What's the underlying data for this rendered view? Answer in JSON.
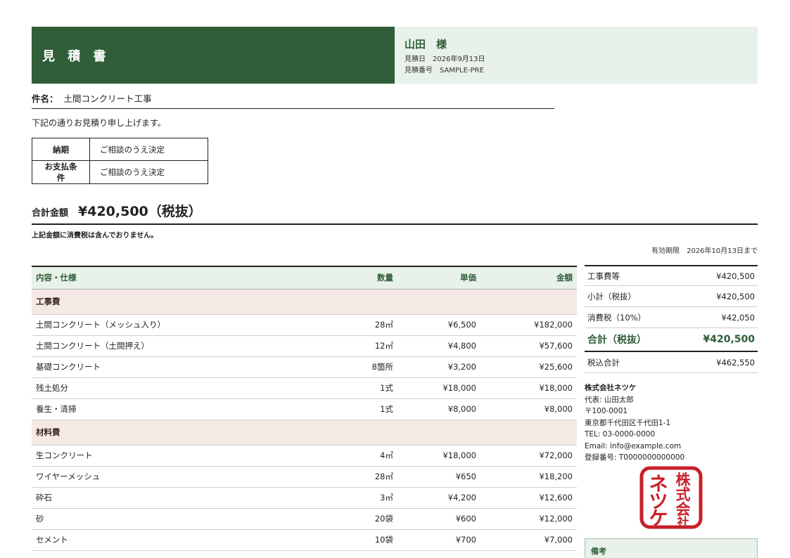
{
  "header": {
    "title": "見 積 書",
    "client": "山田　様",
    "date_label": "見積日",
    "date_value": "2026年9月13日",
    "number_label": "見積番号",
    "number_value": "SAMPLE-PRE"
  },
  "subject": {
    "label": "件名：",
    "value": "土間コンクリート工事"
  },
  "intro": "下記の通りお見積り申し上げます。",
  "terms": [
    {
      "label": "納期",
      "value": "ご相談のうえ決定"
    },
    {
      "label": "お支払条件",
      "value": "ご相談のうえ決定"
    }
  ],
  "total": {
    "label": "合計金額",
    "value": "¥420,500（税抜）"
  },
  "tax_note": "上記金額に消費税は含んでおりません。",
  "validity": {
    "label": "有効期限",
    "value": "2026年10月13日まで"
  },
  "table": {
    "headers": [
      "内容・仕様",
      "数量",
      "単価",
      "金額"
    ],
    "categories": [
      {
        "name": "工事費",
        "rows": [
          [
            "土間コンクリート（メッシュ入り）",
            "28㎡",
            "¥6,500",
            "¥182,000"
          ],
          [
            "土間コンクリート（土間押え）",
            "12㎡",
            "¥4,800",
            "¥57,600"
          ],
          [
            "基礎コンクリート",
            "8箇所",
            "¥3,200",
            "¥25,600"
          ],
          [
            "残土処分",
            "1式",
            "¥18,000",
            "¥18,000"
          ],
          [
            "養生・清掃",
            "1式",
            "¥8,000",
            "¥8,000"
          ]
        ]
      },
      {
        "name": "材料費",
        "rows": [
          [
            "生コンクリート",
            "4㎥",
            "¥18,000",
            "¥72,000"
          ],
          [
            "ワイヤーメッシュ",
            "28㎡",
            "¥650",
            "¥18,200"
          ],
          [
            "砕石",
            "3㎥",
            "¥4,200",
            "¥12,600"
          ],
          [
            "砂",
            "20袋",
            "¥600",
            "¥12,000"
          ],
          [
            "セメント",
            "10袋",
            "¥700",
            "¥7,000"
          ]
        ]
      }
    ]
  },
  "summary": [
    {
      "label": "工事費等",
      "value": "¥420,500"
    },
    {
      "label": "小計（税抜）",
      "value": "¥420,500"
    },
    {
      "label": "消費税（10%）",
      "value": "¥42,050"
    },
    {
      "label": "合計（税抜）",
      "value": "¥420,500"
    },
    {
      "label": "税込合計",
      "value": "¥462,550"
    }
  ],
  "company": {
    "name": "株式会社ネツケ",
    "representative": "代表: 山田太郎",
    "postal": "〒100-0001",
    "address": "東京都千代田区千代田1-1",
    "tel": "TEL: 03-0000-0000",
    "email": "Email: info@example.com",
    "registration": "登録番号: T0000000000000"
  },
  "seal": {
    "text": "株式会社ネツケ",
    "color": "#c8202a"
  },
  "remarks": {
    "label": "備考"
  },
  "colors": {
    "accent": "#2f5e38",
    "accent_light": "#e8f1ea",
    "category_bg": "#f4e9e4",
    "seal": "#c8202a"
  }
}
